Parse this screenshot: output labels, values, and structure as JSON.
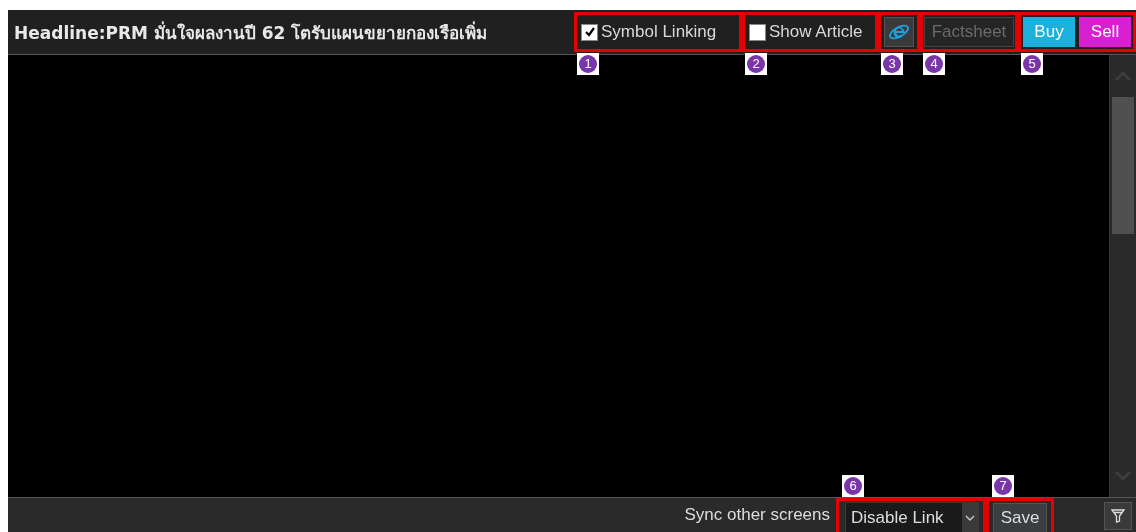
{
  "headline": "Headline:PRM มั่นใจผลงานปี 62 โตรับแผนขยายกองเรือเพิ่ม",
  "toolbar": {
    "symbol_linking": {
      "label": "Symbol Linking",
      "checked": true
    },
    "show_article": {
      "label": "Show Article",
      "checked": false
    },
    "factsheet": {
      "label": "Factsheet",
      "disabled": true
    },
    "buy": "Buy",
    "sell": "Sell"
  },
  "footer": {
    "sync_label": "Sync other screens",
    "link_select": {
      "value": "Disable Link"
    },
    "save": "Save"
  },
  "callouts": [
    "1",
    "2",
    "3",
    "4",
    "5",
    "6",
    "7"
  ]
}
